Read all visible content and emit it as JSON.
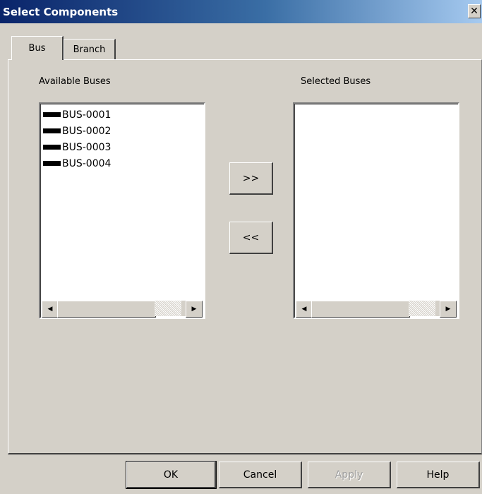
{
  "window": {
    "title": "Select Components",
    "close_glyph": "✕"
  },
  "tabs": [
    {
      "label": "Bus",
      "selected": true
    },
    {
      "label": "Branch",
      "selected": false
    }
  ],
  "available": {
    "label": "Available Buses",
    "items": [
      "BUS-0001",
      "BUS-0002",
      "BUS-0003",
      "BUS-0004"
    ]
  },
  "selected": {
    "label": "Selected Buses",
    "items": []
  },
  "transfer": {
    "add_label": ">>",
    "remove_label": "<<"
  },
  "scroll": {
    "left_glyph": "◀",
    "right_glyph": "▶"
  },
  "footer": {
    "ok_label": "OK",
    "cancel_label": "Cancel",
    "apply_label": "Apply",
    "help_label": "Help"
  }
}
